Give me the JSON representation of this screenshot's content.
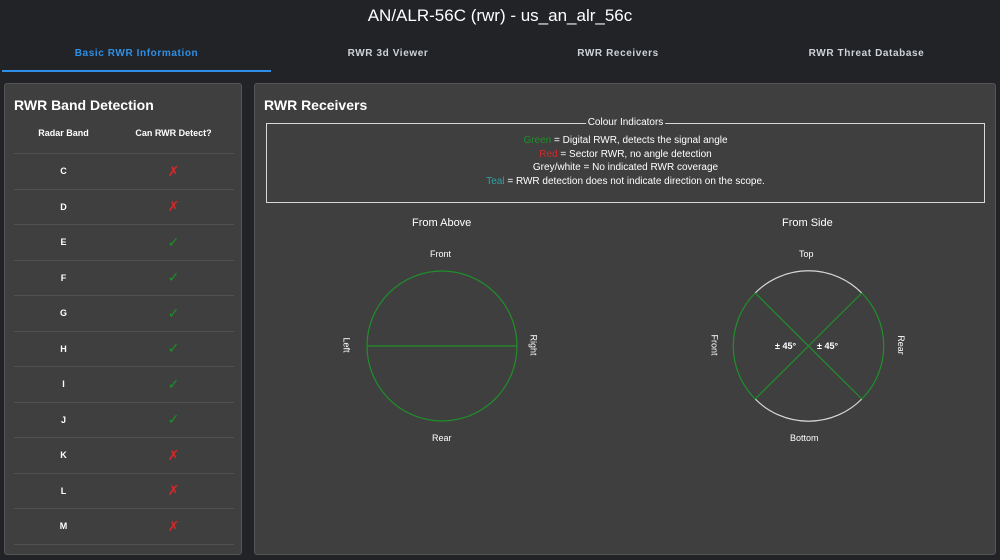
{
  "page": {
    "title": "AN/ALR-56C (rwr) - us_an_alr_56c"
  },
  "tabs": [
    {
      "label": "Basic RWR Information",
      "active": true
    },
    {
      "label": "RWR 3d Viewer",
      "active": false
    },
    {
      "label": "RWR Receivers",
      "active": false
    },
    {
      "label": "RWR Threat Database",
      "active": false
    }
  ],
  "band_panel": {
    "title": "RWR Band Detection",
    "columns": [
      "Radar Band",
      "Can RWR Detect?"
    ],
    "rows": [
      {
        "band": "C",
        "detect": false
      },
      {
        "band": "D",
        "detect": false
      },
      {
        "band": "E",
        "detect": true
      },
      {
        "band": "F",
        "detect": true
      },
      {
        "band": "G",
        "detect": true
      },
      {
        "band": "H",
        "detect": true
      },
      {
        "band": "I",
        "detect": true
      },
      {
        "band": "J",
        "detect": true
      },
      {
        "band": "K",
        "detect": false
      },
      {
        "band": "L",
        "detect": false
      },
      {
        "band": "M",
        "detect": false
      }
    ],
    "icons": {
      "yes": "check-icon",
      "no": "cross-icon"
    }
  },
  "receivers_panel": {
    "title": "RWR Receivers",
    "legend": {
      "title": "Colour Indicators",
      "green_word": "Green",
      "green_text": " = Digital RWR, detects the signal angle",
      "red_word": "Red",
      "red_text": " = Sector RWR, no angle detection",
      "grey_text": "Grey/white = No indicated RWR coverage",
      "teal_word": "Teal",
      "teal_text": " = RWR detection does not indicate direction on the scope."
    },
    "above": {
      "title": "From Above",
      "front": "Front",
      "rear": "Rear",
      "left": "Left",
      "right": "Right"
    },
    "side": {
      "title": "From Side",
      "top": "Top",
      "bottom": "Bottom",
      "front": "Front",
      "rear": "Rear",
      "angle_left": "± 45°",
      "angle_right": "± 45°"
    }
  },
  "colors": {
    "green": "#1f8f2a",
    "red": "#d12a2a",
    "teal": "#2aa6a6",
    "grey": "#d8d8d8",
    "accent": "#2f8fe6"
  }
}
